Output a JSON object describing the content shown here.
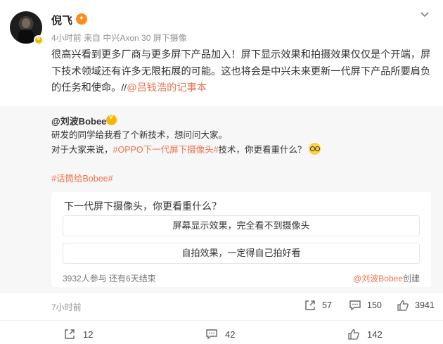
{
  "post": {
    "author": "倪飞",
    "time": "4小时前",
    "source": "来自 中兴Axon 30 屏下摄像",
    "text_main": "很高兴看到更多厂商与更多屏下产品加入！屏下显示效果和拍摄效果仅仅是个开端，屏下技术领域还有许多无限拓展的可能。这也将会是中兴未来更新一代屏下产品所要肩负的任务和使命。//",
    "text_link": "@吕钱浩的记事本"
  },
  "repost": {
    "author": "@刘波Bobee",
    "line1": "研发的同学给我看了个新技术，想问问大家。",
    "line2_prefix": "对于大家来说，",
    "line2_topic": "#OPPO下一代屏下摄像头#",
    "line2_suffix": "技术，你更看重什么？",
    "topic2": "#话筒给Bobee#",
    "poll": {
      "question": "下一代屏下摄像头，你更看重什么？",
      "options": [
        "屏幕显示效果，完全看不到摄像头",
        "自拍效果，一定得自己拍好看"
      ],
      "footer": "3932人参与  还有6天结束",
      "creator_name": "@刘波Bobee",
      "creator_suffix": "创建"
    },
    "time": "7小时前",
    "reposts": "57",
    "comments": "150",
    "likes": "3941"
  },
  "actions": {
    "reposts": "12",
    "comments": "42",
    "likes": "142"
  },
  "colors": {
    "link": "#eb7350",
    "repost_bg": "#f7f7f7"
  }
}
